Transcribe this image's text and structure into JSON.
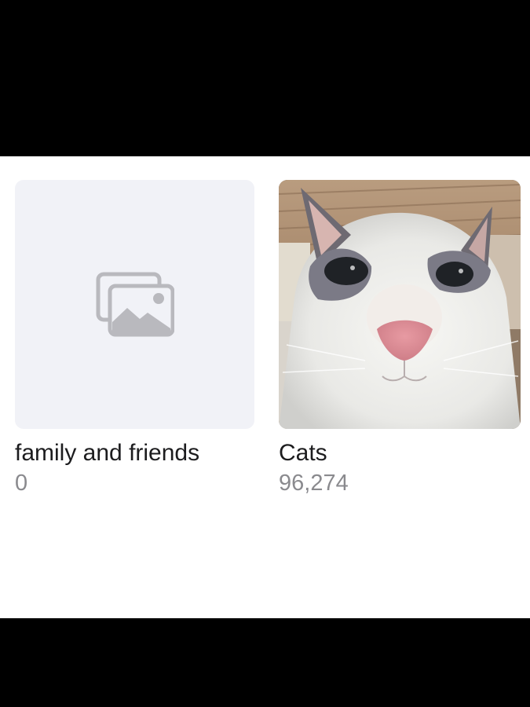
{
  "albums": [
    {
      "title": "family and friends",
      "count": "0",
      "thumbnail": "placeholder-photos-icon"
    },
    {
      "title": "Cats",
      "count": "96,274",
      "thumbnail": "cat-photo"
    }
  ],
  "colors": {
    "placeholder_bg": "#f1f2f7",
    "placeholder_icon": "#b9b9be",
    "title": "#1c1c1e",
    "count": "#8a8a8e"
  }
}
